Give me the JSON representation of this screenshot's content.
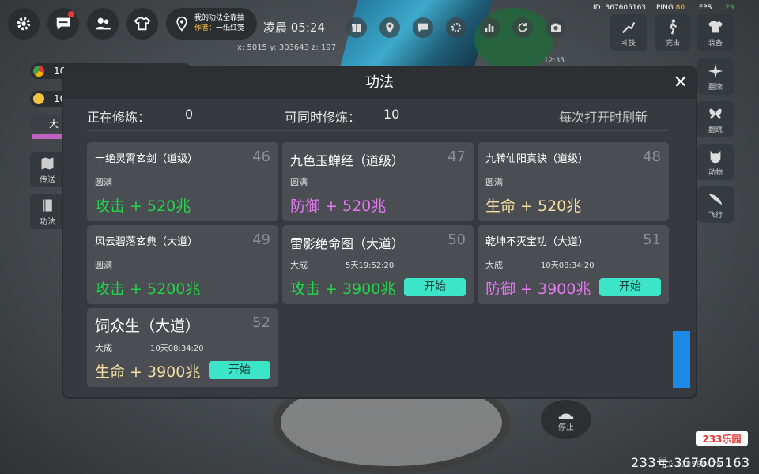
{
  "topbar": {
    "quest_title": "我的功法全靠抽",
    "quest_author_label": "作者：",
    "quest_author": "一纸红笺",
    "clock": "凌晨 05:24",
    "coords": "x: 5015   y: 303643   z: 197",
    "player_id_label": "ID:",
    "player_id": "367605163",
    "ping_label": "PING",
    "ping": "80",
    "fps_label": "FPS",
    "fps": "29",
    "time_small": "12:35"
  },
  "right_buttons": [
    "斗技",
    "竞击",
    "装备",
    "翻滚",
    "翻跳",
    "动物",
    "飞行"
  ],
  "left_pills": [
    "10",
    "10",
    "大"
  ],
  "left_buttons": [
    {
      "label": "传送",
      "icon": "map-icon"
    },
    {
      "label": "功法",
      "icon": "book-icon"
    }
  ],
  "stop_label": "停止",
  "bottom_id": "ID: 128584478",
  "watermark": {
    "logo": "233乐园",
    "text": "233号:367605163"
  },
  "panel": {
    "title": "功法",
    "training_label": "正在修炼：",
    "training_count": "0",
    "simul_label": "可同时修炼：",
    "simul_count": "10",
    "refresh_note": "每次打开时刷新"
  },
  "cards": [
    {
      "name": "十绝灵霄玄剑（道级）",
      "num": "46",
      "level": "圆满",
      "timer": "",
      "bonus": "攻击 + 520兆",
      "bonus_color": "#22d44a",
      "start": ""
    },
    {
      "name": "九色玉蝉经（道级）",
      "num": "47",
      "level": "圆满",
      "timer": "",
      "bonus": "防御 + 520兆",
      "bonus_color": "#e277f0",
      "start": ""
    },
    {
      "name": "九转仙阳真诀（道级）",
      "num": "48",
      "level": "圆满",
      "timer": "",
      "bonus": "生命 + 520兆",
      "bonus_color": "#f5dfa0",
      "start": ""
    },
    {
      "name": "风云碧落玄典（大道）",
      "num": "49",
      "level": "圆满",
      "timer": "",
      "bonus": "攻击 + 5200兆",
      "bonus_color": "#22d44a",
      "start": ""
    },
    {
      "name": "雷影绝命图（大道）",
      "num": "50",
      "level": "大成",
      "timer": "5天19:52:20",
      "bonus": "攻击 + 3900兆",
      "bonus_color": "#22d44a",
      "start": "开始"
    },
    {
      "name": "乾坤不灭宝功（大道）",
      "num": "51",
      "level": "大成",
      "timer": "10天08:34:20",
      "bonus": "防御 + 3900兆",
      "bonus_color": "#e277f0",
      "start": "开始"
    },
    {
      "name": "饲众生（大道）",
      "num": "52",
      "level": "大成",
      "timer": "10天08:34:20",
      "bonus": "生命 + 3900兆",
      "bonus_color": "#f5dfa0",
      "start": "开始"
    }
  ]
}
